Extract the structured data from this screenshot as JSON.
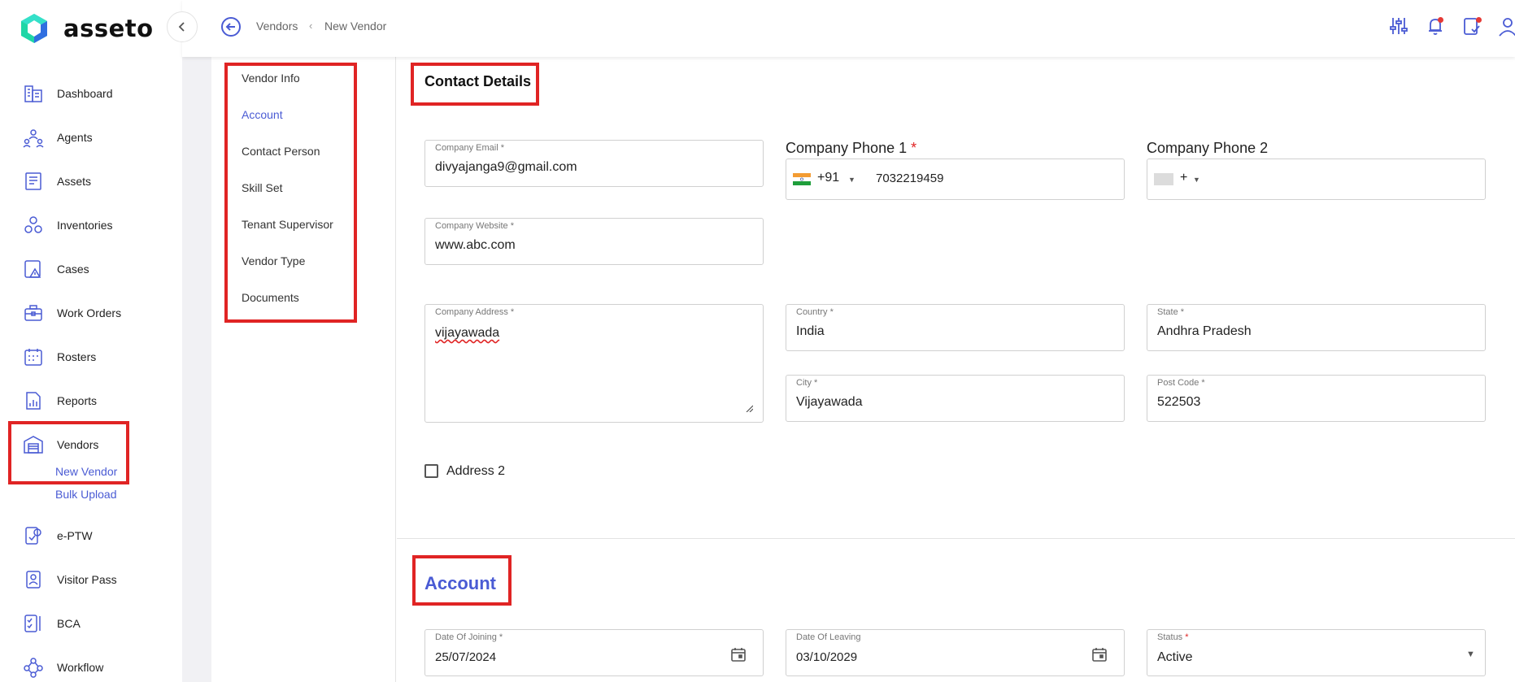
{
  "app": {
    "name": "asseto"
  },
  "sidebar": {
    "items": [
      {
        "label": "Dashboard",
        "icon": "dashboard-building-icon"
      },
      {
        "label": "Agents",
        "icon": "agents-icon"
      },
      {
        "label": "Assets",
        "icon": "assets-icon"
      },
      {
        "label": "Inventories",
        "icon": "inventories-icon"
      },
      {
        "label": "Cases",
        "icon": "cases-icon"
      },
      {
        "label": "Work Orders",
        "icon": "work-orders-icon"
      },
      {
        "label": "Rosters",
        "icon": "rosters-calendar-icon"
      },
      {
        "label": "Reports",
        "icon": "reports-icon"
      },
      {
        "label": "Vendors",
        "icon": "vendors-icon"
      },
      {
        "label": "e-PTW",
        "icon": "eptw-icon"
      },
      {
        "label": "Visitor Pass",
        "icon": "visitor-pass-icon"
      },
      {
        "label": "BCA",
        "icon": "bca-icon"
      },
      {
        "label": "Workflow",
        "icon": "workflow-icon"
      }
    ],
    "vendor_sub": [
      {
        "label": "New Vendor"
      },
      {
        "label": "Bulk Upload"
      }
    ]
  },
  "breadcrumb": {
    "parent": "Vendors",
    "current": "New Vendor"
  },
  "section_nav": {
    "items": [
      "Vendor Info",
      "Account",
      "Contact Person",
      "Skill Set",
      "Tenant Supervisor",
      "Vendor Type",
      "Documents"
    ],
    "active": "Account"
  },
  "contact": {
    "title": "Contact Details",
    "company_email": {
      "label": "Company Email *",
      "value": "divyajanga9@gmail.com"
    },
    "phone1": {
      "label": "Company Phone 1",
      "required": "*",
      "code": "+91",
      "value": "7032219459"
    },
    "phone2": {
      "label": "Company Phone 2",
      "code": "+",
      "value": ""
    },
    "website": {
      "label": "Company Website *",
      "value": "www.abc.com"
    },
    "address": {
      "label": "Company Address *",
      "value": "vijayawada"
    },
    "country": {
      "label": "Country *",
      "value": "India"
    },
    "state": {
      "label": "State *",
      "value": "Andhra Pradesh"
    },
    "city": {
      "label": "City *",
      "value": "Vijayawada"
    },
    "postcode": {
      "label": "Post Code *",
      "value": "522503"
    },
    "address2": {
      "label": "Address 2",
      "checked": false
    }
  },
  "account": {
    "title": "Account",
    "date_of_joining": {
      "label": "Date Of Joining *",
      "value": "25/07/2024"
    },
    "date_of_leaving": {
      "label": "Date Of Leaving",
      "value": "03/10/2029"
    },
    "status": {
      "label": "Status",
      "required": "*",
      "value": "Active"
    }
  },
  "colors": {
    "accent": "#4a5bd4",
    "highlight_red": "#e02424",
    "notification_dot": "#e53935"
  }
}
